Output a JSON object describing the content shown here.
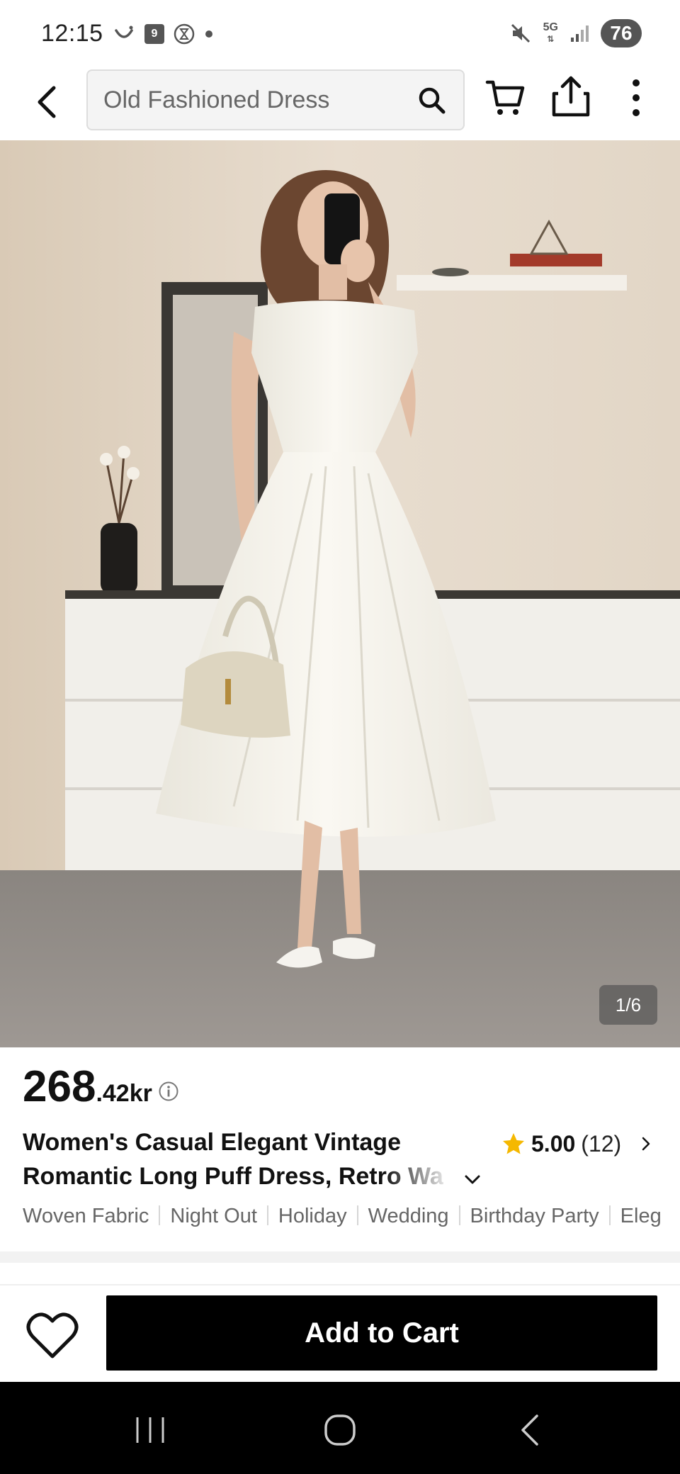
{
  "status_bar": {
    "time": "12:15",
    "calendar_badge": "9",
    "network": "5G",
    "battery": "76"
  },
  "top_nav": {
    "search_value": "Old Fashioned Dress"
  },
  "gallery": {
    "counter": "1/6"
  },
  "product": {
    "price_int": "268",
    "price_dec": ".42",
    "currency": "kr",
    "title_line1": "Women's Casual Elegant Vintage",
    "title_line2": "Romantic Long Puff Dress, Retro Wa",
    "rating_score": "5.00",
    "rating_count": "(12)",
    "tags": [
      "Woven Fabric",
      "Night Out",
      "Holiday",
      "Wedding",
      "Birthday Party",
      "Eleg"
    ]
  },
  "action_bar": {
    "add_to_cart_label": "Add to Cart"
  },
  "colors": {
    "star": "#f5b800",
    "button_bg": "#000000"
  }
}
